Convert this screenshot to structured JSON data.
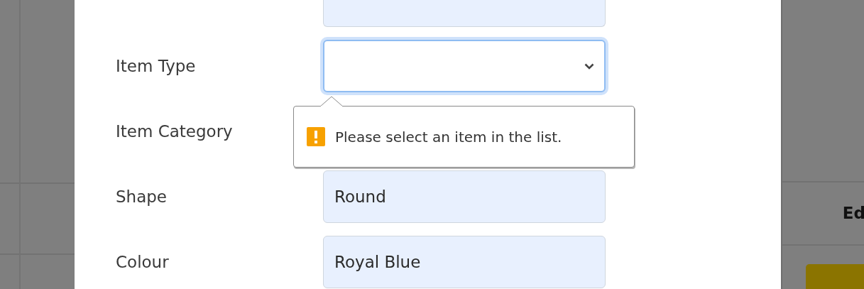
{
  "form": {
    "fields": [
      {
        "kind": "clipped"
      },
      {
        "label": "Item Type",
        "kind": "select",
        "focused": true
      },
      {
        "label": "Item Category",
        "kind": "covered"
      },
      {
        "label": "Shape",
        "kind": "text",
        "value": "Round"
      },
      {
        "label": "Colour",
        "kind": "text",
        "value": "Royal Blue"
      }
    ]
  },
  "validation_tooltip": {
    "message": "Please select an item in the list."
  },
  "background_table": {
    "header": "Ed"
  }
}
